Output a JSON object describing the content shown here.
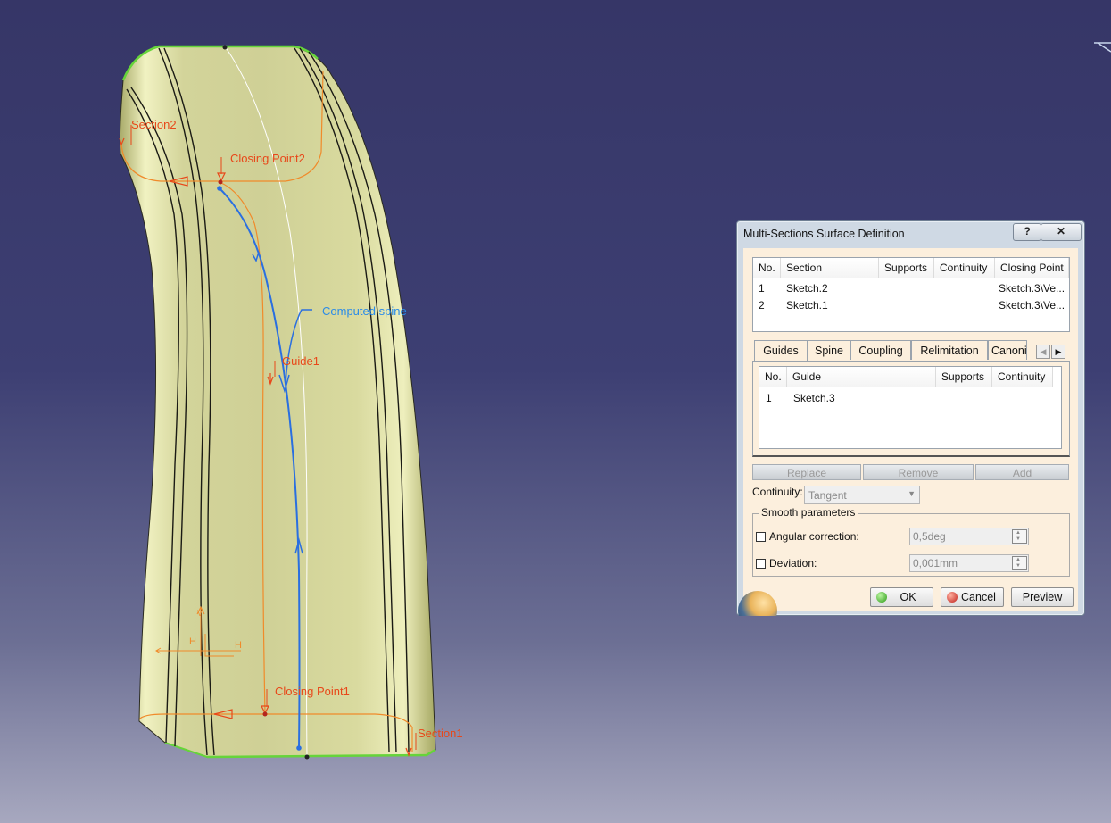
{
  "viewport": {
    "labels": {
      "section2": "Section2",
      "closing_point2": "Closing Point2",
      "computed_spine": "Computed spine",
      "guide1": "Guide1",
      "closing_point1": "Closing Point1",
      "section1": "Section1",
      "axis_h1": "H",
      "axis_h2": "H",
      "axis_v": "V"
    },
    "colors": {
      "surface": "#d8d99c",
      "annotation": "#e8481a",
      "guide_curve": "#f08a2a",
      "spine": "#2a6fe0",
      "boundary": "#66d43a"
    }
  },
  "dialog": {
    "title": "Multi-Sections Surface Definition",
    "help_label": "?",
    "close_label": "✕",
    "sections_table": {
      "headers": [
        "No.",
        "Section",
        "Supports",
        "Continuity",
        "Closing Point"
      ],
      "rows": [
        {
          "no": "1",
          "section": "Sketch.2",
          "supports": "",
          "continuity": "",
          "closing": "Sketch.3\\Ve..."
        },
        {
          "no": "2",
          "section": "Sketch.1",
          "supports": "",
          "continuity": "",
          "closing": "Sketch.3\\Ve..."
        }
      ]
    },
    "tabs": [
      "Guides",
      "Spine",
      "Coupling",
      "Relimitation",
      "Canoni"
    ],
    "guides_table": {
      "headers": [
        "No.",
        "Guide",
        "Supports",
        "Continuity"
      ],
      "rows": [
        {
          "no": "1",
          "guide": "Sketch.3",
          "supports": "",
          "continuity": ""
        }
      ]
    },
    "buttons": {
      "replace": "Replace",
      "remove": "Remove",
      "add": "Add"
    },
    "continuity": {
      "label": "Continuity:",
      "value": "Tangent"
    },
    "smooth": {
      "legend": "Smooth parameters",
      "angular_label": "Angular correction:",
      "angular_value": "0,5deg",
      "deviation_label": "Deviation:",
      "deviation_value": "0,001mm"
    },
    "actions": {
      "ok": "OK",
      "cancel": "Cancel",
      "preview": "Preview"
    }
  }
}
